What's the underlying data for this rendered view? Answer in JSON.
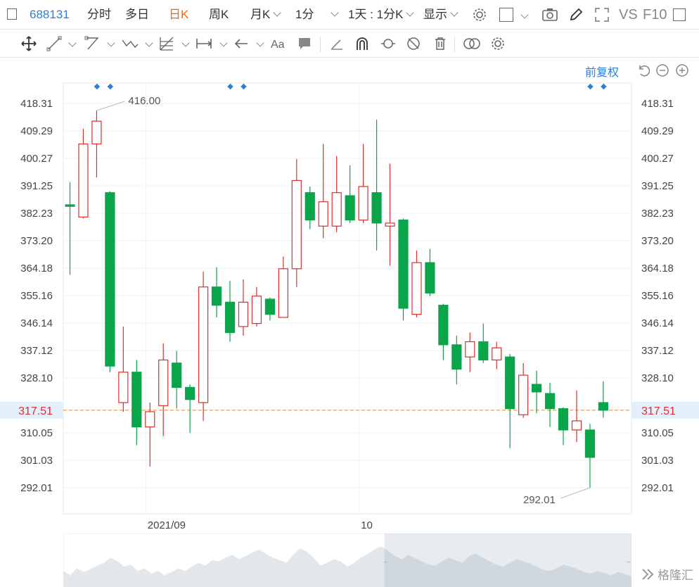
{
  "toolbar": {
    "code": "688131",
    "tabs": [
      "分时",
      "多日",
      "日K",
      "周K",
      "月K",
      "1分"
    ],
    "active_tab": "日K",
    "range_label": "1天 : 1分K",
    "display_label": "显示",
    "vs_label": "VS",
    "f10_label": "F10"
  },
  "adjust_label": "前复权",
  "price_axis": {
    "ticks": [
      "418.31",
      "409.29",
      "400.27",
      "391.25",
      "382.23",
      "373.20",
      "364.18",
      "355.16",
      "346.14",
      "337.12",
      "328.10",
      "310.05",
      "301.03",
      "292.01"
    ],
    "tick_values": [
      418.31,
      409.29,
      400.27,
      391.25,
      382.23,
      373.2,
      364.18,
      355.16,
      346.14,
      337.12,
      328.1,
      310.05,
      301.03,
      292.01
    ]
  },
  "current_price": {
    "label": "317.51",
    "value": 317.51,
    "color": "#e8a060"
  },
  "annotations": {
    "high_label": "416.00",
    "high_value": 416.0,
    "low_label": "292.01",
    "low_value": 292.01
  },
  "x_axis_labels": [
    {
      "label": "2021/09",
      "index": 6
    },
    {
      "label": "10",
      "index": 22
    }
  ],
  "colors": {
    "up": "#d93030",
    "down": "#0aa54a",
    "accent": "#2f7ed8",
    "marker": "#2f7ed8"
  },
  "chart_data": {
    "type": "candlestick",
    "ylim": [
      288.0,
      422.0
    ],
    "candles": [
      {
        "open": 385.0,
        "close": 384.5,
        "high": 392.5,
        "low": 362.0,
        "dir": "down"
      },
      {
        "open": 381.0,
        "close": 405.0,
        "high": 410.0,
        "low": 380.5,
        "dir": "up"
      },
      {
        "open": 405.0,
        "close": 412.5,
        "high": 416.0,
        "low": 394.0,
        "dir": "up"
      },
      {
        "open": 389.0,
        "close": 332.0,
        "high": 389.5,
        "low": 330.0,
        "dir": "down"
      },
      {
        "open": 320.0,
        "close": 330.0,
        "high": 345.0,
        "low": 317.0,
        "dir": "up"
      },
      {
        "open": 330.0,
        "close": 312.0,
        "high": 334.0,
        "low": 306.0,
        "dir": "down"
      },
      {
        "open": 312.0,
        "close": 317.0,
        "high": 320.0,
        "low": 299.0,
        "dir": "up"
      },
      {
        "open": 319.0,
        "close": 334.0,
        "high": 339.5,
        "low": 309.0,
        "dir": "up"
      },
      {
        "open": 333.0,
        "close": 325.0,
        "high": 337.0,
        "low": 318.0,
        "dir": "down"
      },
      {
        "open": 325.0,
        "close": 321.0,
        "high": 326.0,
        "low": 310.0,
        "dir": "down"
      },
      {
        "open": 320.0,
        "close": 358.0,
        "high": 363.0,
        "low": 314.0,
        "dir": "up"
      },
      {
        "open": 358.0,
        "close": 352.0,
        "high": 364.5,
        "low": 348.0,
        "dir": "down"
      },
      {
        "open": 353.0,
        "close": 343.0,
        "high": 360.0,
        "low": 340.0,
        "dir": "down"
      },
      {
        "open": 345.0,
        "close": 353.0,
        "high": 360.5,
        "low": 342.0,
        "dir": "up"
      },
      {
        "open": 346.0,
        "close": 355.0,
        "high": 358.0,
        "low": 345.0,
        "dir": "up"
      },
      {
        "open": 354.0,
        "close": 349.0,
        "high": 354.5,
        "low": 347.0,
        "dir": "down"
      },
      {
        "open": 348.0,
        "close": 364.0,
        "high": 368.0,
        "low": 348.0,
        "dir": "up"
      },
      {
        "open": 364.0,
        "close": 393.0,
        "high": 400.0,
        "low": 358.0,
        "dir": "up"
      },
      {
        "open": 389.0,
        "close": 380.0,
        "high": 391.0,
        "low": 377.0,
        "dir": "down"
      },
      {
        "open": 378.0,
        "close": 386.0,
        "high": 405.0,
        "low": 374.0,
        "dir": "up"
      },
      {
        "open": 378.0,
        "close": 389.0,
        "high": 401.0,
        "low": 376.0,
        "dir": "up"
      },
      {
        "open": 388.0,
        "close": 380.0,
        "high": 398.0,
        "low": 379.0,
        "dir": "down"
      },
      {
        "open": 380.0,
        "close": 391.0,
        "high": 405.0,
        "low": 379.0,
        "dir": "up"
      },
      {
        "open": 389.0,
        "close": 379.0,
        "high": 413.0,
        "low": 370.0,
        "dir": "down"
      },
      {
        "open": 378.0,
        "close": 379.0,
        "high": 398.5,
        "low": 365.0,
        "dir": "up"
      },
      {
        "open": 380.0,
        "close": 351.0,
        "high": 380.5,
        "low": 347.0,
        "dir": "down"
      },
      {
        "open": 349.0,
        "close": 366.0,
        "high": 370.0,
        "low": 348.0,
        "dir": "up"
      },
      {
        "open": 366.0,
        "close": 356.0,
        "high": 370.5,
        "low": 355.0,
        "dir": "down"
      },
      {
        "open": 352.0,
        "close": 339.0,
        "high": 352.5,
        "low": 334.0,
        "dir": "down"
      },
      {
        "open": 339.0,
        "close": 331.0,
        "high": 342.0,
        "low": 326.0,
        "dir": "down"
      },
      {
        "open": 335.0,
        "close": 340.0,
        "high": 343.0,
        "low": 330.0,
        "dir": "up"
      },
      {
        "open": 340.0,
        "close": 334.0,
        "high": 346.0,
        "low": 333.0,
        "dir": "down"
      },
      {
        "open": 334.0,
        "close": 338.0,
        "high": 340.0,
        "low": 331.0,
        "dir": "up"
      },
      {
        "open": 335.0,
        "close": 318.0,
        "high": 336.0,
        "low": 305.0,
        "dir": "down"
      },
      {
        "open": 316.0,
        "close": 329.0,
        "high": 333.0,
        "low": 315.0,
        "dir": "up"
      },
      {
        "open": 326.0,
        "close": 323.5,
        "high": 330.5,
        "low": 316.5,
        "dir": "down"
      },
      {
        "open": 323.0,
        "close": 318.0,
        "high": 326.5,
        "low": 312.0,
        "dir": "down"
      },
      {
        "open": 318.0,
        "close": 311.0,
        "high": 318.5,
        "low": 306.0,
        "dir": "down"
      },
      {
        "open": 311.0,
        "close": 314.0,
        "high": 324.0,
        "low": 307.0,
        "dir": "up"
      },
      {
        "open": 311.0,
        "close": 302.0,
        "high": 313.0,
        "low": 292.0,
        "dir": "down"
      },
      {
        "open": 317.5,
        "close": 320.0,
        "high": 327.0,
        "low": 315.0,
        "dir": "down"
      }
    ],
    "dot_marker_indices": [
      2,
      3,
      12,
      13,
      39,
      40
    ]
  },
  "navigator": {
    "values": [
      0.3,
      0.22,
      0.35,
      0.28,
      0.33,
      0.4,
      0.45,
      0.55,
      0.48,
      0.38,
      0.42,
      0.3,
      0.35,
      0.25,
      0.3,
      0.22,
      0.28,
      0.35,
      0.3,
      0.38,
      0.45,
      0.4,
      0.5,
      0.48,
      0.55,
      0.6,
      0.52,
      0.58,
      0.65,
      0.7,
      0.62,
      0.55,
      0.5,
      0.45,
      0.6,
      0.72,
      0.66,
      0.55,
      0.4,
      0.45,
      0.52,
      0.48,
      0.38,
      0.45,
      0.55,
      0.62,
      0.7,
      0.76,
      0.68,
      0.58,
      0.52,
      0.6,
      0.54,
      0.48,
      0.42,
      0.4,
      0.48,
      0.55,
      0.5,
      0.45,
      0.58,
      0.62,
      0.55,
      0.48,
      0.42,
      0.38,
      0.45,
      0.52,
      0.48,
      0.44,
      0.38,
      0.32,
      0.3,
      0.36,
      0.42,
      0.38,
      0.34,
      0.28,
      0.25,
      0.3,
      0.26,
      0.22,
      0.28,
      0.24,
      0.2
    ],
    "selection_start": 0.565,
    "left_arrow": "←",
    "right_arrow": "→"
  },
  "watermark": "格隆汇"
}
